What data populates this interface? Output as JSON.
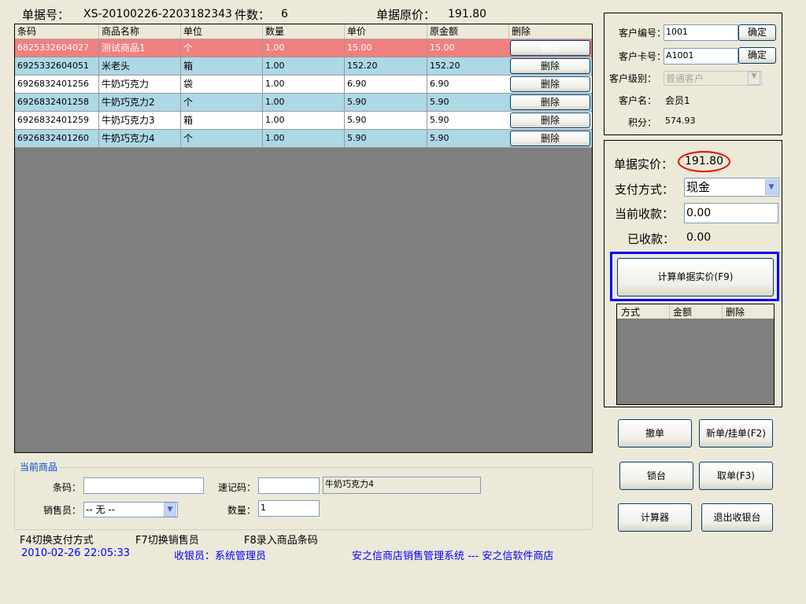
{
  "header": {
    "doc_no_label": "单据号：",
    "doc_no": "XS-20100226-2203182343",
    "count_label": "件数：",
    "count": "6",
    "orig_price_label": "单据原价：",
    "orig_price": "191.80"
  },
  "table": {
    "columns": [
      "条码",
      "商品名称",
      "单位",
      "数量",
      "单价",
      "原金额",
      "删除"
    ],
    "rows": [
      [
        "6825332604027",
        "测试商品1",
        "个",
        "1.00",
        "15.00",
        "15.00",
        "删除"
      ],
      [
        "6925332604051",
        "米老头",
        "箱",
        "1.00",
        "152.20",
        "152.20",
        "删除"
      ],
      [
        "6926832401256",
        "牛奶巧克力",
        "袋",
        "1.00",
        "6.90",
        "6.90",
        "删除"
      ],
      [
        "6926832401258",
        "牛奶巧克力2",
        "个",
        "1.00",
        "5.90",
        "5.90",
        "删除"
      ],
      [
        "6926832401259",
        "牛奶巧克力3",
        "箱",
        "1.00",
        "5.90",
        "5.90",
        "删除"
      ],
      [
        "6926832401260",
        "牛奶巧克力4",
        "个",
        "1.00",
        "5.90",
        "5.90",
        "删除"
      ]
    ]
  },
  "customer": {
    "id_label": "客户编号：",
    "id": "1001",
    "confirm": "确定",
    "card_label": "客户卡号：",
    "card": "A1001",
    "level_label": "客户级别：",
    "level": "普通客户",
    "name_label": "客户名：",
    "name": "会员1",
    "points_label": "积分：",
    "points": "574.93"
  },
  "payment": {
    "actual_label": "单据实价：",
    "actual": "191.80",
    "method_label": "支付方式：",
    "method": "现金",
    "current_label": "当前收款：",
    "current": "0.00",
    "received_label": "已收款：",
    "received": "0.00",
    "calc_button": "计算单据实价(F9)",
    "columns": [
      "方式",
      "金额",
      "删除"
    ]
  },
  "actions": {
    "cancel": "撤单",
    "new": "新单/挂单(F2)",
    "lock": "锁台",
    "retrieve": "取单(F3)",
    "calculator": "计算器",
    "exit": "退出收银台"
  },
  "current_item": {
    "legend": "当前商品",
    "barcode_label": "条码：",
    "barcode": "",
    "quick_label": "速记码：",
    "quick": "",
    "product_name": "牛奶巧克力4",
    "seller_label": "销售员：",
    "seller": "-- 无 --",
    "qty_label": "数量：",
    "qty": "1"
  },
  "hints": [
    "F4切换支付方式",
    "F7切换销售员",
    "F8录入商品条码"
  ],
  "status": {
    "datetime": "2010-02-26 22:05:33",
    "cashier": "收银员：系统管理员",
    "system": "安之信商店销售管理系统 --- 安之信软件商店"
  }
}
